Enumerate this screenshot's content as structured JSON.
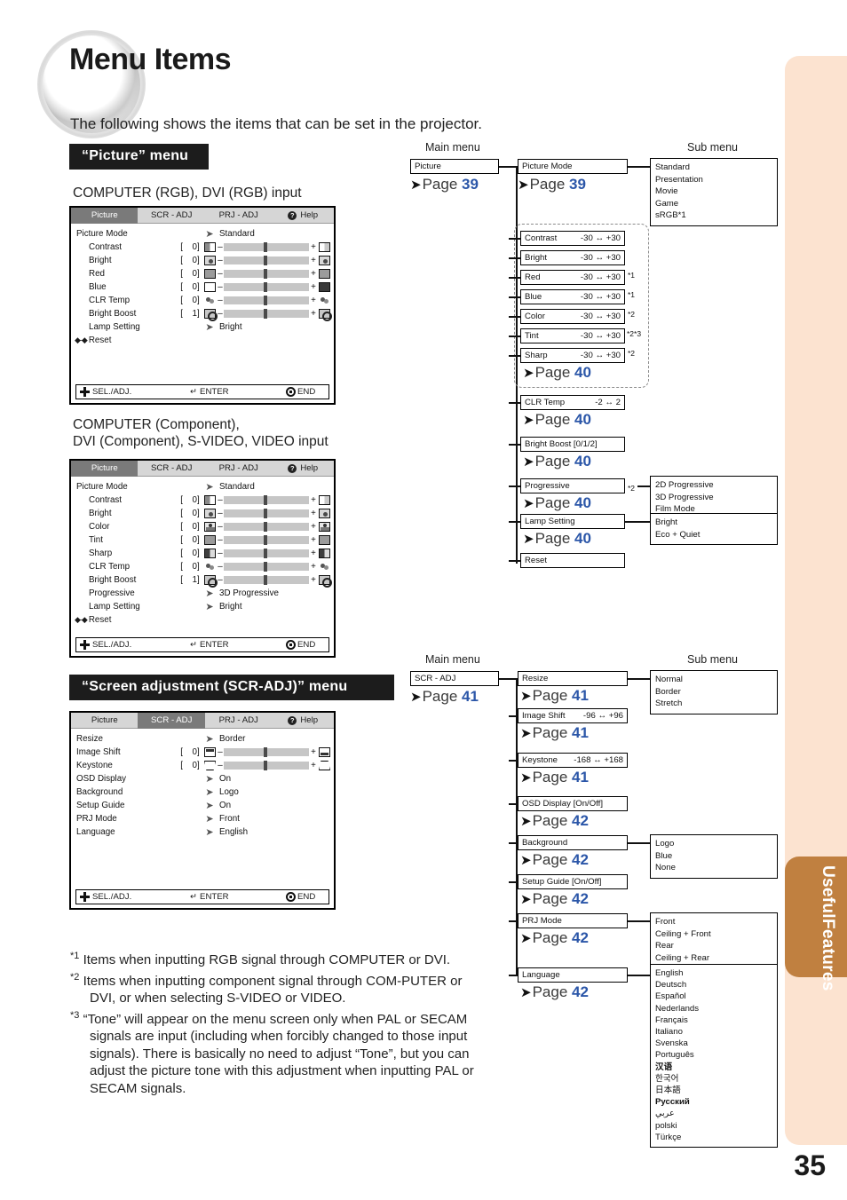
{
  "page": {
    "title": "Menu Items",
    "intro": "The following shows the items that can be set in the projector.",
    "folio": "35",
    "side_tab": "Useful\nFeatures",
    "side_tab_line1": "Useful",
    "side_tab_line2": "Features",
    "accent_blue": "#2b56a8",
    "tab_brown": "#c08040",
    "tab_peach": "#fce3d0"
  },
  "sections": {
    "picture_header": "“Picture” menu",
    "scradj_header": "“Screen adjustment (SCR-ADJ)” menu",
    "caption1": "COMPUTER (RGB), DVI (RGB) input",
    "caption2_line1": "COMPUTER (Component),",
    "caption2_line2": "DVI (Component), S-VIDEO, VIDEO input"
  },
  "osd_common": {
    "tabs": [
      "Picture",
      "SCR - ADJ",
      "PRJ - ADJ",
      "Help"
    ],
    "help_icon": "?",
    "footer": {
      "sel": "SEL./ADJ.",
      "enter": "ENTER",
      "end": "END"
    },
    "reset": "Reset",
    "bracket_open": "[",
    "bracket_close": "]",
    "minus": "–",
    "plus": "+"
  },
  "osd1": {
    "selected_tab": "Picture",
    "rows": [
      {
        "label": "Picture Mode",
        "type": "choice",
        "value": "Standard"
      },
      {
        "label": "Contrast",
        "type": "slider",
        "value": "0",
        "icon": "contrast-icon"
      },
      {
        "label": "Bright",
        "type": "slider",
        "value": "0",
        "icon": "bright-icon"
      },
      {
        "label": "Red",
        "type": "slider",
        "value": "0",
        "icon": "red-icon"
      },
      {
        "label": "Blue",
        "type": "slider",
        "value": "0",
        "icon": "blue-icon"
      },
      {
        "label": "CLR Temp",
        "type": "slider",
        "value": "0",
        "icon": "clr-temp-icon"
      },
      {
        "label": "Bright Boost",
        "type": "slider",
        "value": "1",
        "icon": "bright-boost-icon"
      },
      {
        "label": "Lamp Setting",
        "type": "choice",
        "value": "Bright"
      }
    ]
  },
  "osd2": {
    "selected_tab": "Picture",
    "rows": [
      {
        "label": "Picture Mode",
        "type": "choice",
        "value": "Standard"
      },
      {
        "label": "Contrast",
        "type": "slider",
        "value": "0",
        "icon": "contrast-icon"
      },
      {
        "label": "Bright",
        "type": "slider",
        "value": "0",
        "icon": "bright-icon"
      },
      {
        "label": "Color",
        "type": "slider",
        "value": "0",
        "icon": "color-icon"
      },
      {
        "label": "Tint",
        "type": "slider",
        "value": "0",
        "icon": "tint-icon"
      },
      {
        "label": "Sharp",
        "type": "slider",
        "value": "0",
        "icon": "sharp-icon"
      },
      {
        "label": "CLR Temp",
        "type": "slider",
        "value": "0",
        "icon": "clr-temp-icon"
      },
      {
        "label": "Bright Boost",
        "type": "slider",
        "value": "1",
        "icon": "bright-boost-icon"
      },
      {
        "label": "Progressive",
        "type": "choice",
        "value": "3D Progressive"
      },
      {
        "label": "Lamp Setting",
        "type": "choice",
        "value": "Bright"
      }
    ]
  },
  "osd3": {
    "selected_tab": "SCR - ADJ",
    "rows": [
      {
        "label": "Resize",
        "type": "choice",
        "value": "Border"
      },
      {
        "label": "Image Shift",
        "type": "slider",
        "value": "0",
        "icon": "image-shift-icon"
      },
      {
        "label": "Keystone",
        "type": "slider",
        "value": "0",
        "icon": "keystone-icon"
      },
      {
        "label": "OSD Display",
        "type": "choice",
        "value": "On"
      },
      {
        "label": "Background",
        "type": "choice",
        "value": "Logo"
      },
      {
        "label": "Setup Guide",
        "type": "choice",
        "value": "On"
      },
      {
        "label": "PRJ Mode",
        "type": "choice",
        "value": "Front"
      },
      {
        "label": "Language",
        "type": "choice",
        "value": "English"
      }
    ]
  },
  "flow_picture": {
    "main_menu_label": "Main menu",
    "sub_menu_label": "Sub menu",
    "root": {
      "name": "Picture",
      "page_word": "Page",
      "page": "39"
    },
    "picture_mode": {
      "name": "Picture Mode",
      "page_word": "Page",
      "page": "39"
    },
    "picture_mode_options": [
      "Standard",
      "Presentation",
      "Movie",
      "Game",
      "sRGB*1"
    ],
    "dashed_group": {
      "items": [
        {
          "name": "Contrast",
          "range": "-30 ↔ +30",
          "note": ""
        },
        {
          "name": "Bright",
          "range": "-30 ↔ +30",
          "note": ""
        },
        {
          "name": "Red",
          "range": "-30 ↔ +30",
          "note": "*1"
        },
        {
          "name": "Blue",
          "range": "-30 ↔ +30",
          "note": "*1"
        },
        {
          "name": "Color",
          "range": "-30 ↔ +30",
          "note": "*2"
        },
        {
          "name": "Tint",
          "range": "-30 ↔ +30",
          "note": "*2*3"
        },
        {
          "name": "Sharp",
          "range": "-30 ↔ +30",
          "note": "*2"
        }
      ],
      "page_word": "Page",
      "page": "40"
    },
    "clr_temp": {
      "name": "CLR Temp",
      "range": "-2 ↔ 2",
      "page_word": "Page",
      "page": "40"
    },
    "bright_boost": {
      "name": "Bright Boost [0/1/2]",
      "page_word": "Page",
      "page": "40"
    },
    "progressive": {
      "name": "Progressive",
      "note": "*2",
      "page_word": "Page",
      "page": "40",
      "options": [
        "2D Progressive",
        "3D Progressive",
        "Film Mode"
      ]
    },
    "lamp_setting": {
      "name": "Lamp Setting",
      "page_word": "Page",
      "page": "40",
      "options": [
        "Bright",
        "Eco + Quiet"
      ]
    },
    "reset": {
      "name": "Reset"
    }
  },
  "flow_scradj": {
    "main_menu_label": "Main menu",
    "sub_menu_label": "Sub menu",
    "root": {
      "name": "SCR - ADJ",
      "page_word": "Page",
      "page": "41"
    },
    "resize": {
      "name": "Resize",
      "page_word": "Page",
      "page": "41",
      "options": [
        "Normal",
        "Border",
        "Stretch"
      ]
    },
    "image_shift": {
      "name": "Image Shift",
      "range": "-96 ↔ +96",
      "page_word": "Page",
      "page": "41"
    },
    "keystone": {
      "name": "Keystone",
      "range": "-168 ↔ +168",
      "page_word": "Page",
      "page": "41"
    },
    "osd_display": {
      "name": "OSD Display [On/Off]",
      "page_word": "Page",
      "page": "42"
    },
    "background": {
      "name": "Background",
      "page_word": "Page",
      "page": "42",
      "options": [
        "Logo",
        "Blue",
        "None"
      ]
    },
    "setup_guide": {
      "name": "Setup Guide [On/Off]",
      "page_word": "Page",
      "page": "42"
    },
    "prj_mode": {
      "name": "PRJ Mode",
      "page_word": "Page",
      "page": "42",
      "options": [
        "Front",
        "Ceiling + Front",
        "Rear",
        "Ceiling + Rear"
      ]
    },
    "language": {
      "name": "Language",
      "page_word": "Page",
      "page": "42",
      "options": [
        "English",
        "Deutsch",
        "Español",
        "Nederlands",
        "Français",
        "Italiano",
        "Svenska",
        "Português",
        "汉语",
        "한국어",
        "日本語",
        "Русский",
        "عربي",
        "polski",
        "Türkçe"
      ]
    }
  },
  "footnotes": {
    "n1_marker": "*1",
    "n1": "Items when inputting RGB signal through COMPUTER or DVI.",
    "n2_marker": "*2",
    "n2": "Items when inputting component signal through COM-PUTER or DVI, or when selecting S-VIDEO or VIDEO.",
    "n3_marker": "*3",
    "n3": "“Tone” will appear on the menu screen only when PAL or SECAM signals are input (including when forcibly changed to those input signals). There is basically no need to adjust “Tone”, but you can adjust the picture tone with this adjustment when inputting PAL or SECAM signals."
  }
}
